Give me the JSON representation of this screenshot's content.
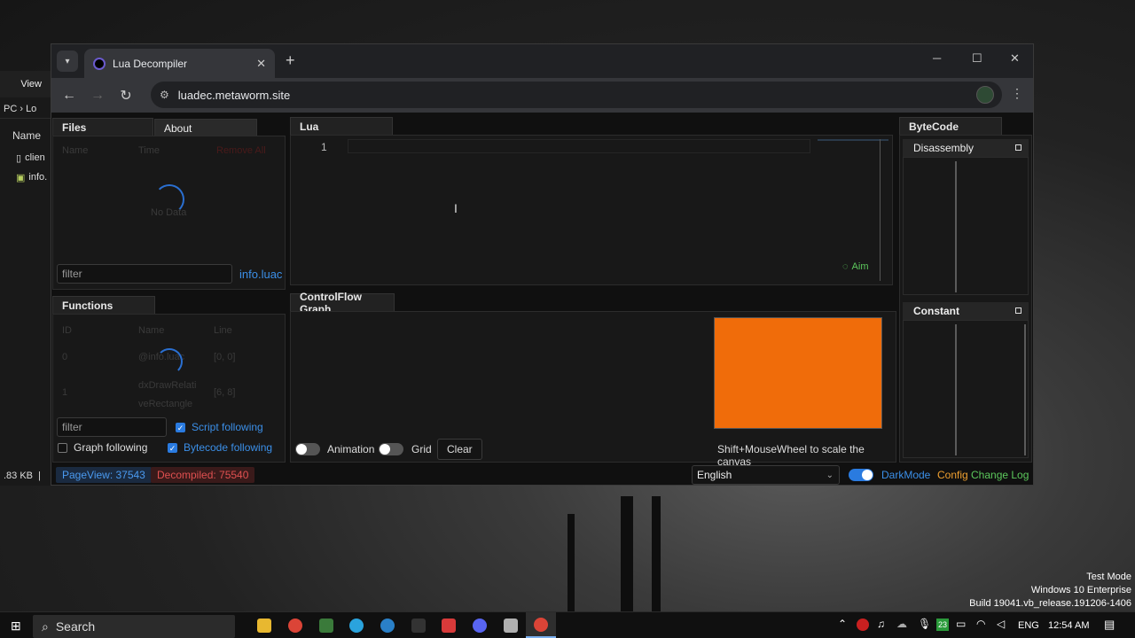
{
  "explorer": {
    "menu_view": "View",
    "path_pc": "PC",
    "path_next": "Lo",
    "col_name": "Name",
    "files": [
      "clien",
      "info."
    ],
    "status": ".83 KB"
  },
  "browser": {
    "tab_title": "Lua Decompiler",
    "url": "luadec.metaworm.site"
  },
  "files_panel": {
    "tab_files": "Files",
    "tab_about": "About",
    "col_name": "Name",
    "col_time": "Time",
    "remove_all": "Remove All",
    "empty": "No Data",
    "filter_placeholder": "filter",
    "current_file": "info.luac"
  },
  "functions_panel": {
    "tab": "Functions",
    "cols": [
      "ID",
      "Name",
      "Line"
    ],
    "rows": [
      {
        "id": "0",
        "name": "@info.luac",
        "line": "[0, 0]"
      },
      {
        "id": "1",
        "name": "dxDrawRelati veRectangle",
        "line": "[6, 8]"
      }
    ],
    "filter_placeholder": "filter",
    "script_following": "Script following",
    "graph_following": "Graph following",
    "bytecode_following": "Bytecode following"
  },
  "lua_panel": {
    "tab": "Lua",
    "line_number": "1",
    "aim_label": "Aim"
  },
  "cfg_panel": {
    "tab": "ControlFlow Graph",
    "animation": "Animation",
    "grid": "Grid",
    "clear": "Clear",
    "hint": "Shift+MouseWheel to scale the canvas",
    "canvas_color": "#f06c0a"
  },
  "bytecode_panel": {
    "tab": "ByteCode",
    "disassembly": "Disassembly",
    "constant": "Constant"
  },
  "statusbar": {
    "pageview": "PageView: 37543",
    "decompiled": "Decompiled: 75540",
    "language": "English",
    "darkmode": "DarkMode",
    "config": "Config",
    "changelog": "Change Log"
  },
  "desktop_watermark": {
    "line1": "Test Mode",
    "line2": "Windows 10 Enterprise",
    "line3": "Build 19041.vb_release.191206-1406"
  },
  "taskbar": {
    "search": "Search",
    "lang": "ENG",
    "time": "12:54 AM",
    "tray_badge": "23"
  },
  "colors": {
    "accent_blue": "#2a7be0",
    "decompiled_red": "#e05050",
    "config_orange": "#f0a030",
    "changelog_green": "#5cc85c"
  }
}
